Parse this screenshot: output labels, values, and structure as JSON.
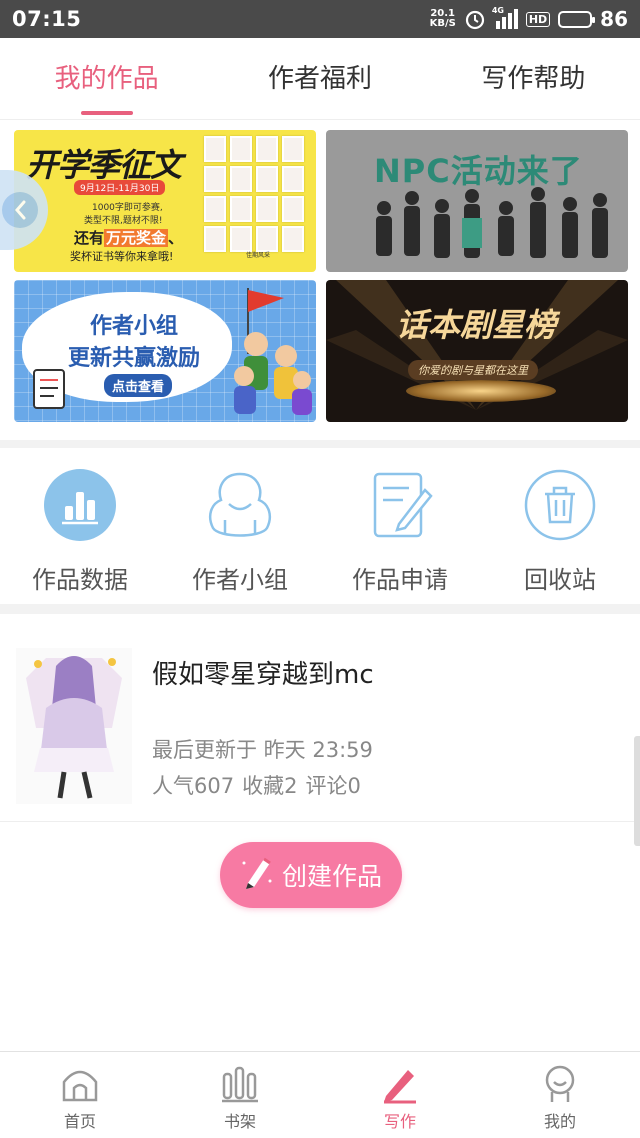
{
  "status_bar": {
    "time": "07:15",
    "net_speed": "20.1",
    "net_unit": "KB/S",
    "signal_label": "4G",
    "hd_label": "HD",
    "battery": "86"
  },
  "tabs": [
    {
      "label": "我的作品",
      "active": true
    },
    {
      "label": "作者福利",
      "active": false
    },
    {
      "label": "写作帮助",
      "active": false
    }
  ],
  "banners": {
    "b1": {
      "title": "开学季征文",
      "date": "9月12日-11月30日",
      "line1": "1000字即可参赛,",
      "line2": "类型不限,题材不限!",
      "line3_pre": "还有",
      "line3_hl": "万元奖金",
      "line3_post": "、",
      "line4": "奖杯证书等你来拿哦!",
      "brand": "佳期风采"
    },
    "b2": {
      "title": "NPC活动来了"
    },
    "b3": {
      "title1": "作者小组",
      "title2": "更新共赢激励",
      "cta": "点击查看"
    },
    "b4": {
      "title": "话本剧星榜",
      "subtitle": "你爱的剧与星都在这里"
    }
  },
  "actions": [
    {
      "label": "作品数据",
      "icon": "bar-chart-icon"
    },
    {
      "label": "作者小组",
      "icon": "group-icon"
    },
    {
      "label": "作品申请",
      "icon": "edit-doc-icon"
    },
    {
      "label": "回收站",
      "icon": "trash-icon"
    }
  ],
  "work": {
    "title": "假如零星穿越到mc",
    "updated": "最后更新于 昨天 23:59",
    "popularity": "人气607",
    "favorites": "收藏2",
    "comments": "评论0"
  },
  "create_button": {
    "label": "创建作品"
  },
  "bottom_nav": [
    {
      "label": "首页",
      "icon": "home-icon",
      "active": false
    },
    {
      "label": "书架",
      "icon": "bookshelf-icon",
      "active": false
    },
    {
      "label": "写作",
      "icon": "pen-icon",
      "active": true
    },
    {
      "label": "我的",
      "icon": "profile-icon",
      "active": false
    }
  ],
  "colors": {
    "accent": "#e8607e",
    "button_pink": "#f77aa3",
    "icon_blue": "#8cc3ea",
    "status_bar": "#4a4a4a"
  }
}
